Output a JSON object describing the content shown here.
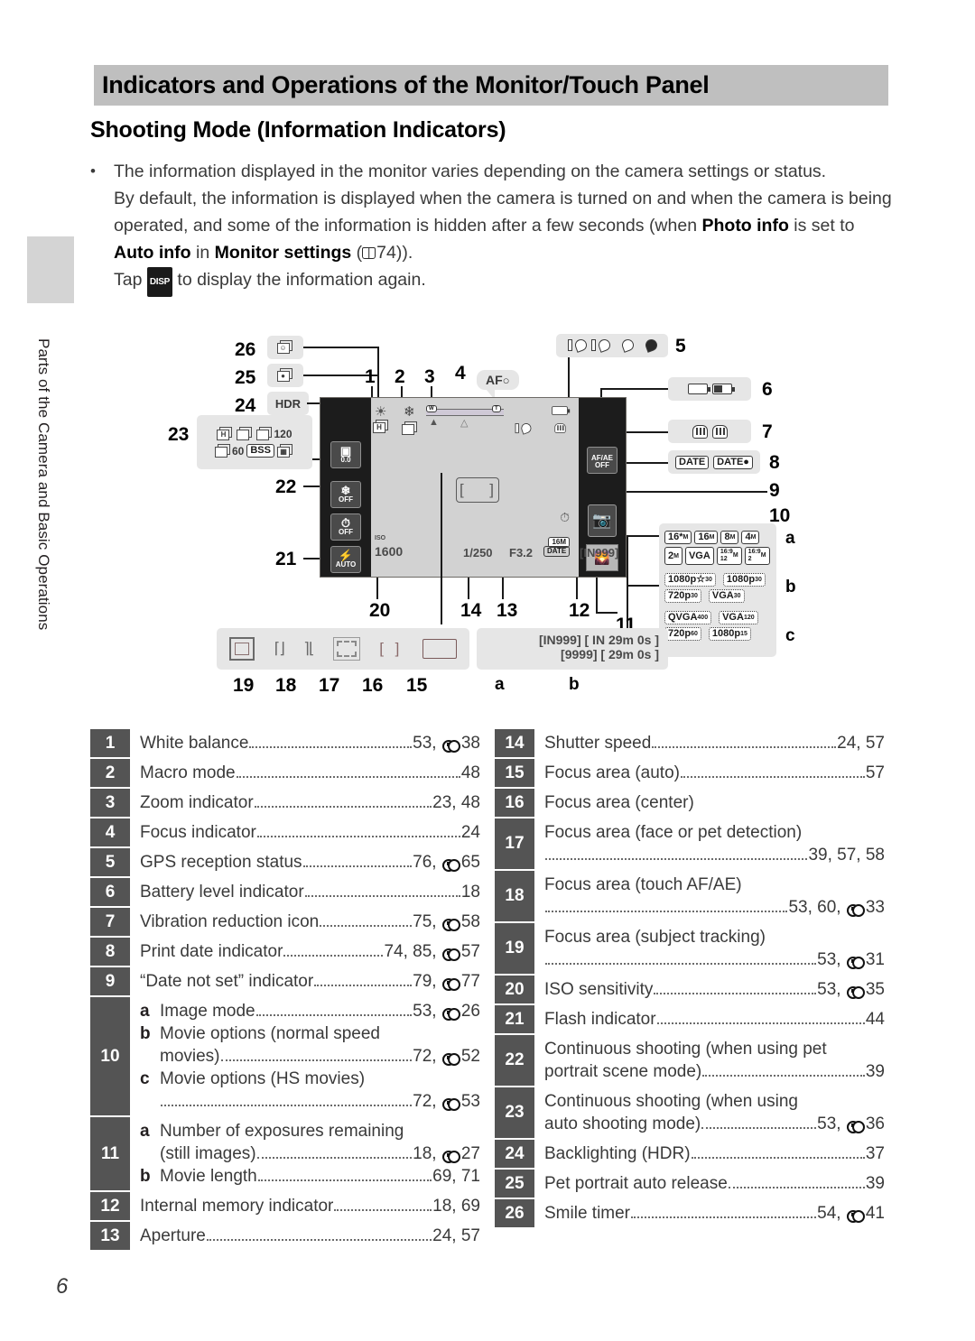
{
  "chapter_tab": {
    "label": "Parts of the Camera and Basic Operations"
  },
  "header": {
    "title": "Indicators and Operations of the Monitor/Touch Panel"
  },
  "section": {
    "title": "Shooting Mode (Information Indicators)"
  },
  "intro": {
    "bullet": "•",
    "line1": "The information displayed in the monitor varies depending on the camera settings or status.",
    "line2_a": "By default, the information is displayed when the camera is turned on and when the camera is being operated, and some of the information is hidden after a few seconds (when ",
    "bold1": "Photo info",
    "line2_b": " is set to ",
    "bold2": "Auto info",
    "line2_c": " in ",
    "bold3": "Monitor settings",
    "line2_d": " (",
    "ref_page": "74",
    "line2_e": ")).",
    "line3_a": "Tap ",
    "disp_label": "DISP",
    "line3_b": " to display the information again."
  },
  "diagram": {
    "callouts": [
      "1",
      "2",
      "3",
      "4",
      "5",
      "6",
      "7",
      "8",
      "9",
      "10",
      "11",
      "12",
      "13",
      "14",
      "15",
      "16",
      "17",
      "18",
      "19",
      "20",
      "21",
      "22",
      "23",
      "24",
      "25",
      "26"
    ],
    "sub_letters": [
      "a",
      "b",
      "c"
    ],
    "monitor": {
      "af_indicator": "AF",
      "exposure_comp": "0.0",
      "macro": "OFF",
      "selftimer": "OFF",
      "flash": "AUTO",
      "iso_label": "ISO",
      "iso_value": "1600",
      "shutter_speed": "1/250",
      "aperture": "F3.2",
      "date_stamp": "DATE",
      "exposures_remaining": "[IN999]",
      "image_mode_badge": "16M",
      "af_ae": "AF/AE",
      "af_ae_sub": "OFF",
      "zoom_wide": "W",
      "zoom_tele": "T"
    },
    "group24_hdr": "HDR",
    "group23_icons": [
      "H",
      "",
      "120",
      "60",
      "BSS",
      ""
    ],
    "group10a_image_modes": [
      "16*M",
      "16M",
      "8M",
      "4M",
      "2M",
      "VGA",
      "16:9 12M",
      "16:9 2M"
    ],
    "group10b_movie_normal": [
      "1080p★ 30",
      "1080p 30",
      "720p 30",
      "VGA 30"
    ],
    "group10c_movie_hs": [
      "QVGA 400",
      "VGA 120",
      "720p 60",
      "1080p 15"
    ],
    "focus_area_row_numbers": [
      "19",
      "18",
      "17",
      "16",
      "15"
    ],
    "counter_group": {
      "line1": "[IN999] [ IN   29m    0s ]",
      "line2": "[9999] [        29m    0s ]",
      "letter_a": "a",
      "letter_b": "b"
    }
  },
  "legend_left": [
    {
      "num": "1",
      "lines": [
        {
          "label": "White balance",
          "page": "53, ●38",
          "ebook": true,
          "dots": true
        }
      ]
    },
    {
      "num": "2",
      "lines": [
        {
          "label": "Macro mode",
          "page": "48",
          "dots": true
        }
      ]
    },
    {
      "num": "3",
      "lines": [
        {
          "label": "Zoom indicator",
          "page": "23, 48",
          "dots": true
        }
      ]
    },
    {
      "num": "4",
      "lines": [
        {
          "label": "Focus indicator",
          "page": "24",
          "dots": true
        }
      ]
    },
    {
      "num": "5",
      "lines": [
        {
          "label": "GPS reception status",
          "page": "76, ●65",
          "ebook": true,
          "dots": true
        }
      ]
    },
    {
      "num": "6",
      "lines": [
        {
          "label": "Battery level indicator",
          "page": "18",
          "dots": true
        }
      ]
    },
    {
      "num": "7",
      "lines": [
        {
          "label": "Vibration reduction icon",
          "page": "75, ●58",
          "ebook": true,
          "dots": true
        }
      ]
    },
    {
      "num": "8",
      "lines": [
        {
          "label": "Print date indicator",
          "page": "74, 85, ●57",
          "ebook": true,
          "dots": true
        }
      ]
    },
    {
      "num": "9",
      "lines": [
        {
          "label": "“Date not set” indicator",
          "page": "79, ●77",
          "ebook": true,
          "dots": true
        }
      ]
    },
    {
      "num": "10",
      "sublines": [
        {
          "key": "a",
          "label": "Image mode",
          "page": "53, ●26",
          "ebook": true,
          "dots": true
        },
        {
          "key": "b",
          "label": "Movie options (normal speed",
          "label2": "movies)",
          "page": "72, ●52",
          "ebook": true,
          "dots": true
        },
        {
          "key": "c",
          "label": "Movie options (HS movies)",
          "page": "72, ●53",
          "ebook": true,
          "dots": true,
          "page_on_new_line": true
        }
      ]
    },
    {
      "num": "11",
      "sublines": [
        {
          "key": "a",
          "label": "Number of exposures remaining",
          "label2": "(still images)",
          "page": "18, ●27",
          "ebook": true,
          "dots": true
        },
        {
          "key": "b",
          "label": "Movie length",
          "page": "69, 71",
          "dots": true
        }
      ]
    },
    {
      "num": "12",
      "lines": [
        {
          "label": "Internal memory indicator",
          "page": "18, 69",
          "dots": true
        }
      ]
    },
    {
      "num": "13",
      "lines": [
        {
          "label": "Aperture",
          "page": "24, 57",
          "dots": true
        }
      ]
    }
  ],
  "legend_right": [
    {
      "num": "14",
      "lines": [
        {
          "label": "Shutter speed",
          "page": "24, 57",
          "dots": true
        }
      ]
    },
    {
      "num": "15",
      "lines": [
        {
          "label": "Focus area (auto)",
          "page": "57",
          "dots": true
        }
      ]
    },
    {
      "num": "16",
      "lines": [
        {
          "label": "Focus area (center)",
          "page": "",
          "dots": false
        }
      ]
    },
    {
      "num": "17",
      "lines": [
        {
          "label": "Focus area (face or pet detection)",
          "page": "39, 57, 58",
          "dots": true,
          "page_on_new_line": true
        }
      ]
    },
    {
      "num": "18",
      "lines": [
        {
          "label": "Focus area (touch AF/AE)",
          "page": "53, 60, ●33",
          "ebook": true,
          "dots": true,
          "page_on_new_line": true
        }
      ]
    },
    {
      "num": "19",
      "lines": [
        {
          "label": "Focus area (subject tracking)",
          "page": "53, ●31",
          "ebook": true,
          "dots": true,
          "page_on_new_line": true
        }
      ]
    },
    {
      "num": "20",
      "lines": [
        {
          "label": "ISO sensitivity",
          "page": "53, ●35",
          "ebook": true,
          "dots": true
        }
      ]
    },
    {
      "num": "21",
      "lines": [
        {
          "label": "Flash indicator",
          "page": "44",
          "dots": true
        }
      ]
    },
    {
      "num": "22",
      "lines": [
        {
          "label": "Continuous shooting (when using pet",
          "label2": "portrait scene mode)",
          "page": "39",
          "dots": true
        }
      ]
    },
    {
      "num": "23",
      "lines": [
        {
          "label": "Continuous shooting (when using",
          "label2": "auto shooting mode)",
          "page": "53, ●36",
          "ebook": true,
          "dots": true
        }
      ]
    },
    {
      "num": "24",
      "lines": [
        {
          "label": "Backlighting (HDR)",
          "page": "37",
          "dots": true
        }
      ]
    },
    {
      "num": "25",
      "lines": [
        {
          "label": "Pet portrait auto release",
          "page": "39",
          "dots": true
        }
      ]
    },
    {
      "num": "26",
      "lines": [
        {
          "label": "Smile timer",
          "page": "54, ●41",
          "ebook": true,
          "dots": true
        }
      ]
    }
  ],
  "page_number": "6"
}
